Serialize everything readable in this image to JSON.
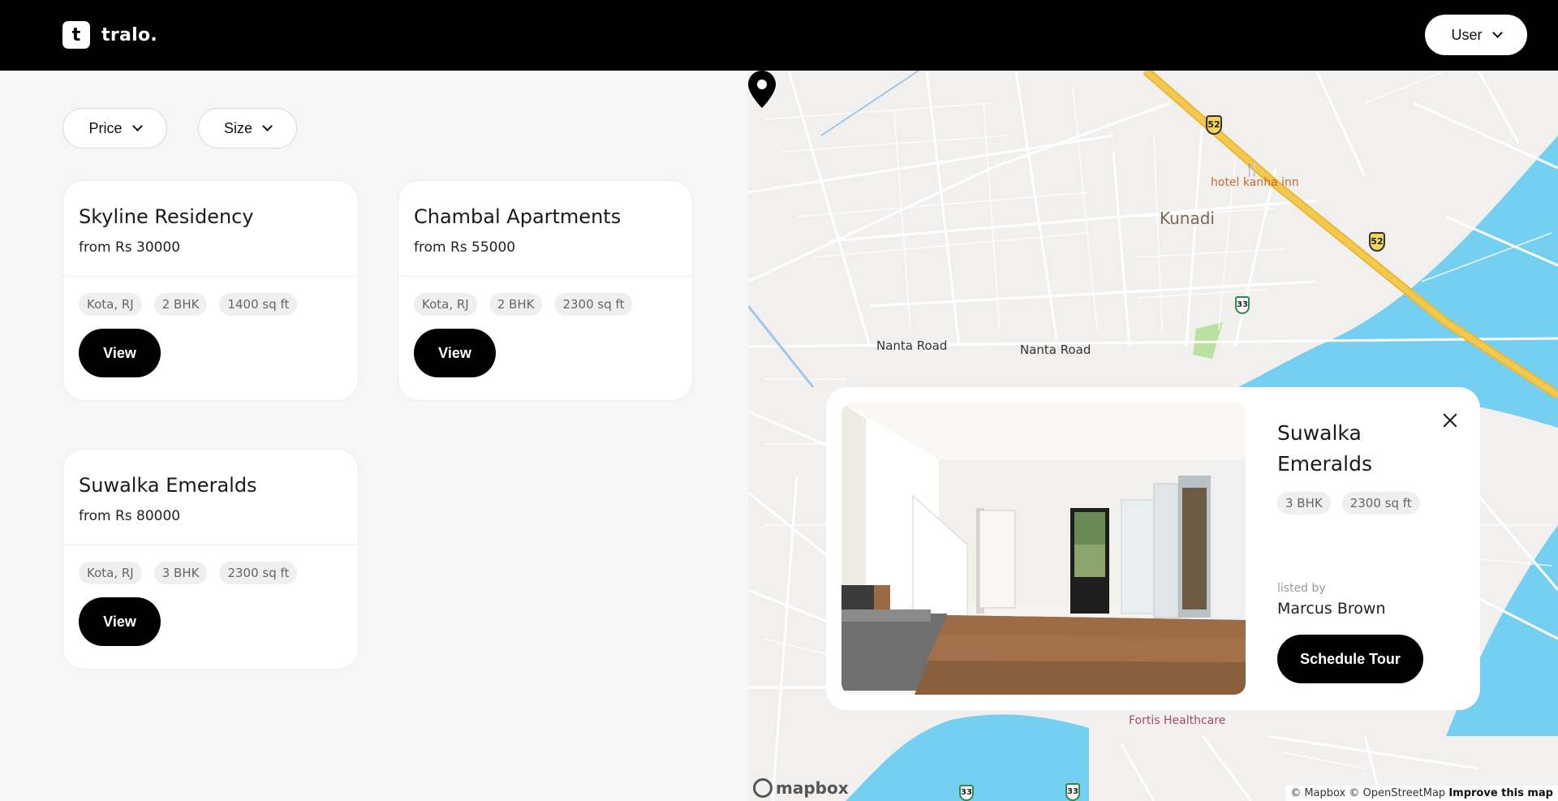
{
  "header": {
    "logo_mark": "t",
    "logo_text": "tralo.",
    "user_button": "User"
  },
  "filters": {
    "price": "Price",
    "size": "Size"
  },
  "listings": [
    {
      "title": "Skyline Residency",
      "price": "from Rs 30000",
      "tags": [
        "Kota, RJ",
        "2 BHK",
        "1400 sq ft"
      ],
      "view_label": "View"
    },
    {
      "title": "Chambal Apartments",
      "price": "from Rs 55000",
      "tags": [
        "Kota, RJ",
        "2 BHK",
        "2300 sq ft"
      ],
      "view_label": "View"
    },
    {
      "title": "Suwalka Emeralds",
      "price": "from Rs 80000",
      "tags": [
        "Kota, RJ",
        "3 BHK",
        "2300 sq ft"
      ],
      "view_label": "View"
    }
  ],
  "map": {
    "labels": {
      "kunadi": "Kunadi",
      "hotel": "hotel kanha inn",
      "road1": "Nanta Road",
      "road2": "Nanta Road",
      "fortis": "Fortis Healthcare",
      "shield_52a": "52",
      "shield_52b": "52",
      "shield_33a": "33",
      "shield_33b": "33",
      "shield_33c": "33"
    },
    "logo": "mapbox",
    "attribution": "© Mapbox © OpenStreetMap",
    "improve": "Improve this map",
    "colors": {
      "water": "#75cff0",
      "highway": "#f2c94c",
      "land": "#f1f0ee",
      "park": "#b9e2a0"
    }
  },
  "popup": {
    "title": "Suwalka Emeralds",
    "tags": [
      "3 BHK",
      "2300 sq ft"
    ],
    "listed_by_label": "listed by",
    "agent": "Marcus Brown",
    "tour_button": "Schedule Tour"
  }
}
